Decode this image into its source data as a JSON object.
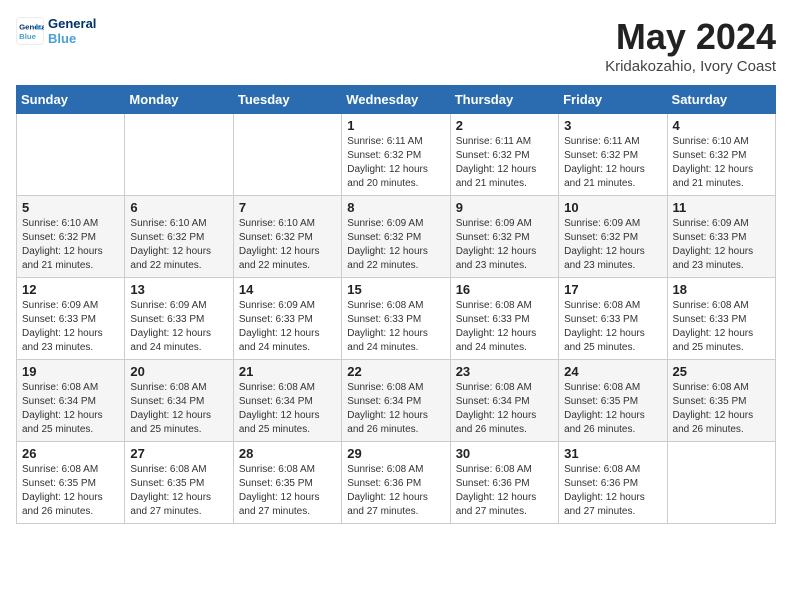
{
  "header": {
    "logo_line1": "General",
    "logo_line2": "Blue",
    "month": "May 2024",
    "location": "Kridakozahio, Ivory Coast"
  },
  "weekdays": [
    "Sunday",
    "Monday",
    "Tuesday",
    "Wednesday",
    "Thursday",
    "Friday",
    "Saturday"
  ],
  "weeks": [
    [
      {
        "day": "",
        "info": ""
      },
      {
        "day": "",
        "info": ""
      },
      {
        "day": "",
        "info": ""
      },
      {
        "day": "1",
        "info": "Sunrise: 6:11 AM\nSunset: 6:32 PM\nDaylight: 12 hours\nand 20 minutes."
      },
      {
        "day": "2",
        "info": "Sunrise: 6:11 AM\nSunset: 6:32 PM\nDaylight: 12 hours\nand 21 minutes."
      },
      {
        "day": "3",
        "info": "Sunrise: 6:11 AM\nSunset: 6:32 PM\nDaylight: 12 hours\nand 21 minutes."
      },
      {
        "day": "4",
        "info": "Sunrise: 6:10 AM\nSunset: 6:32 PM\nDaylight: 12 hours\nand 21 minutes."
      }
    ],
    [
      {
        "day": "5",
        "info": "Sunrise: 6:10 AM\nSunset: 6:32 PM\nDaylight: 12 hours\nand 21 minutes."
      },
      {
        "day": "6",
        "info": "Sunrise: 6:10 AM\nSunset: 6:32 PM\nDaylight: 12 hours\nand 22 minutes."
      },
      {
        "day": "7",
        "info": "Sunrise: 6:10 AM\nSunset: 6:32 PM\nDaylight: 12 hours\nand 22 minutes."
      },
      {
        "day": "8",
        "info": "Sunrise: 6:09 AM\nSunset: 6:32 PM\nDaylight: 12 hours\nand 22 minutes."
      },
      {
        "day": "9",
        "info": "Sunrise: 6:09 AM\nSunset: 6:32 PM\nDaylight: 12 hours\nand 23 minutes."
      },
      {
        "day": "10",
        "info": "Sunrise: 6:09 AM\nSunset: 6:32 PM\nDaylight: 12 hours\nand 23 minutes."
      },
      {
        "day": "11",
        "info": "Sunrise: 6:09 AM\nSunset: 6:33 PM\nDaylight: 12 hours\nand 23 minutes."
      }
    ],
    [
      {
        "day": "12",
        "info": "Sunrise: 6:09 AM\nSunset: 6:33 PM\nDaylight: 12 hours\nand 23 minutes."
      },
      {
        "day": "13",
        "info": "Sunrise: 6:09 AM\nSunset: 6:33 PM\nDaylight: 12 hours\nand 24 minutes."
      },
      {
        "day": "14",
        "info": "Sunrise: 6:09 AM\nSunset: 6:33 PM\nDaylight: 12 hours\nand 24 minutes."
      },
      {
        "day": "15",
        "info": "Sunrise: 6:08 AM\nSunset: 6:33 PM\nDaylight: 12 hours\nand 24 minutes."
      },
      {
        "day": "16",
        "info": "Sunrise: 6:08 AM\nSunset: 6:33 PM\nDaylight: 12 hours\nand 24 minutes."
      },
      {
        "day": "17",
        "info": "Sunrise: 6:08 AM\nSunset: 6:33 PM\nDaylight: 12 hours\nand 25 minutes."
      },
      {
        "day": "18",
        "info": "Sunrise: 6:08 AM\nSunset: 6:33 PM\nDaylight: 12 hours\nand 25 minutes."
      }
    ],
    [
      {
        "day": "19",
        "info": "Sunrise: 6:08 AM\nSunset: 6:34 PM\nDaylight: 12 hours\nand 25 minutes."
      },
      {
        "day": "20",
        "info": "Sunrise: 6:08 AM\nSunset: 6:34 PM\nDaylight: 12 hours\nand 25 minutes."
      },
      {
        "day": "21",
        "info": "Sunrise: 6:08 AM\nSunset: 6:34 PM\nDaylight: 12 hours\nand 25 minutes."
      },
      {
        "day": "22",
        "info": "Sunrise: 6:08 AM\nSunset: 6:34 PM\nDaylight: 12 hours\nand 26 minutes."
      },
      {
        "day": "23",
        "info": "Sunrise: 6:08 AM\nSunset: 6:34 PM\nDaylight: 12 hours\nand 26 minutes."
      },
      {
        "day": "24",
        "info": "Sunrise: 6:08 AM\nSunset: 6:35 PM\nDaylight: 12 hours\nand 26 minutes."
      },
      {
        "day": "25",
        "info": "Sunrise: 6:08 AM\nSunset: 6:35 PM\nDaylight: 12 hours\nand 26 minutes."
      }
    ],
    [
      {
        "day": "26",
        "info": "Sunrise: 6:08 AM\nSunset: 6:35 PM\nDaylight: 12 hours\nand 26 minutes."
      },
      {
        "day": "27",
        "info": "Sunrise: 6:08 AM\nSunset: 6:35 PM\nDaylight: 12 hours\nand 27 minutes."
      },
      {
        "day": "28",
        "info": "Sunrise: 6:08 AM\nSunset: 6:35 PM\nDaylight: 12 hours\nand 27 minutes."
      },
      {
        "day": "29",
        "info": "Sunrise: 6:08 AM\nSunset: 6:36 PM\nDaylight: 12 hours\nand 27 minutes."
      },
      {
        "day": "30",
        "info": "Sunrise: 6:08 AM\nSunset: 6:36 PM\nDaylight: 12 hours\nand 27 minutes."
      },
      {
        "day": "31",
        "info": "Sunrise: 6:08 AM\nSunset: 6:36 PM\nDaylight: 12 hours\nand 27 minutes."
      },
      {
        "day": "",
        "info": ""
      }
    ]
  ]
}
